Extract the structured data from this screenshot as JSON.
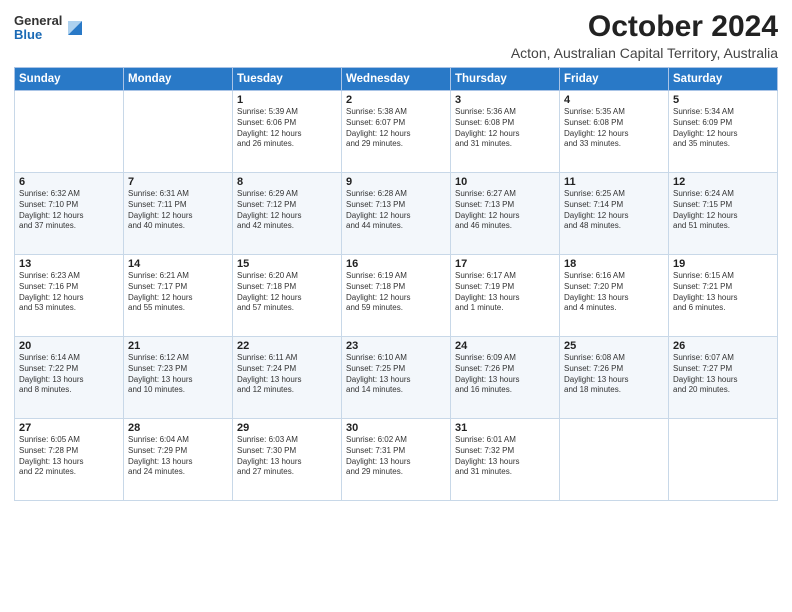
{
  "header": {
    "logo_general": "General",
    "logo_blue": "Blue",
    "title": "October 2024",
    "subtitle": "Acton, Australian Capital Territory, Australia"
  },
  "days_of_week": [
    "Sunday",
    "Monday",
    "Tuesday",
    "Wednesday",
    "Thursday",
    "Friday",
    "Saturday"
  ],
  "weeks": [
    [
      {
        "day": "",
        "info": ""
      },
      {
        "day": "",
        "info": ""
      },
      {
        "day": "1",
        "info": "Sunrise: 5:39 AM\nSunset: 6:06 PM\nDaylight: 12 hours\nand 26 minutes."
      },
      {
        "day": "2",
        "info": "Sunrise: 5:38 AM\nSunset: 6:07 PM\nDaylight: 12 hours\nand 29 minutes."
      },
      {
        "day": "3",
        "info": "Sunrise: 5:36 AM\nSunset: 6:08 PM\nDaylight: 12 hours\nand 31 minutes."
      },
      {
        "day": "4",
        "info": "Sunrise: 5:35 AM\nSunset: 6:08 PM\nDaylight: 12 hours\nand 33 minutes."
      },
      {
        "day": "5",
        "info": "Sunrise: 5:34 AM\nSunset: 6:09 PM\nDaylight: 12 hours\nand 35 minutes."
      }
    ],
    [
      {
        "day": "6",
        "info": "Sunrise: 6:32 AM\nSunset: 7:10 PM\nDaylight: 12 hours\nand 37 minutes."
      },
      {
        "day": "7",
        "info": "Sunrise: 6:31 AM\nSunset: 7:11 PM\nDaylight: 12 hours\nand 40 minutes."
      },
      {
        "day": "8",
        "info": "Sunrise: 6:29 AM\nSunset: 7:12 PM\nDaylight: 12 hours\nand 42 minutes."
      },
      {
        "day": "9",
        "info": "Sunrise: 6:28 AM\nSunset: 7:13 PM\nDaylight: 12 hours\nand 44 minutes."
      },
      {
        "day": "10",
        "info": "Sunrise: 6:27 AM\nSunset: 7:13 PM\nDaylight: 12 hours\nand 46 minutes."
      },
      {
        "day": "11",
        "info": "Sunrise: 6:25 AM\nSunset: 7:14 PM\nDaylight: 12 hours\nand 48 minutes."
      },
      {
        "day": "12",
        "info": "Sunrise: 6:24 AM\nSunset: 7:15 PM\nDaylight: 12 hours\nand 51 minutes."
      }
    ],
    [
      {
        "day": "13",
        "info": "Sunrise: 6:23 AM\nSunset: 7:16 PM\nDaylight: 12 hours\nand 53 minutes."
      },
      {
        "day": "14",
        "info": "Sunrise: 6:21 AM\nSunset: 7:17 PM\nDaylight: 12 hours\nand 55 minutes."
      },
      {
        "day": "15",
        "info": "Sunrise: 6:20 AM\nSunset: 7:18 PM\nDaylight: 12 hours\nand 57 minutes."
      },
      {
        "day": "16",
        "info": "Sunrise: 6:19 AM\nSunset: 7:18 PM\nDaylight: 12 hours\nand 59 minutes."
      },
      {
        "day": "17",
        "info": "Sunrise: 6:17 AM\nSunset: 7:19 PM\nDaylight: 13 hours\nand 1 minute."
      },
      {
        "day": "18",
        "info": "Sunrise: 6:16 AM\nSunset: 7:20 PM\nDaylight: 13 hours\nand 4 minutes."
      },
      {
        "day": "19",
        "info": "Sunrise: 6:15 AM\nSunset: 7:21 PM\nDaylight: 13 hours\nand 6 minutes."
      }
    ],
    [
      {
        "day": "20",
        "info": "Sunrise: 6:14 AM\nSunset: 7:22 PM\nDaylight: 13 hours\nand 8 minutes."
      },
      {
        "day": "21",
        "info": "Sunrise: 6:12 AM\nSunset: 7:23 PM\nDaylight: 13 hours\nand 10 minutes."
      },
      {
        "day": "22",
        "info": "Sunrise: 6:11 AM\nSunset: 7:24 PM\nDaylight: 13 hours\nand 12 minutes."
      },
      {
        "day": "23",
        "info": "Sunrise: 6:10 AM\nSunset: 7:25 PM\nDaylight: 13 hours\nand 14 minutes."
      },
      {
        "day": "24",
        "info": "Sunrise: 6:09 AM\nSunset: 7:26 PM\nDaylight: 13 hours\nand 16 minutes."
      },
      {
        "day": "25",
        "info": "Sunrise: 6:08 AM\nSunset: 7:26 PM\nDaylight: 13 hours\nand 18 minutes."
      },
      {
        "day": "26",
        "info": "Sunrise: 6:07 AM\nSunset: 7:27 PM\nDaylight: 13 hours\nand 20 minutes."
      }
    ],
    [
      {
        "day": "27",
        "info": "Sunrise: 6:05 AM\nSunset: 7:28 PM\nDaylight: 13 hours\nand 22 minutes."
      },
      {
        "day": "28",
        "info": "Sunrise: 6:04 AM\nSunset: 7:29 PM\nDaylight: 13 hours\nand 24 minutes."
      },
      {
        "day": "29",
        "info": "Sunrise: 6:03 AM\nSunset: 7:30 PM\nDaylight: 13 hours\nand 27 minutes."
      },
      {
        "day": "30",
        "info": "Sunrise: 6:02 AM\nSunset: 7:31 PM\nDaylight: 13 hours\nand 29 minutes."
      },
      {
        "day": "31",
        "info": "Sunrise: 6:01 AM\nSunset: 7:32 PM\nDaylight: 13 hours\nand 31 minutes."
      },
      {
        "day": "",
        "info": ""
      },
      {
        "day": "",
        "info": ""
      }
    ]
  ]
}
